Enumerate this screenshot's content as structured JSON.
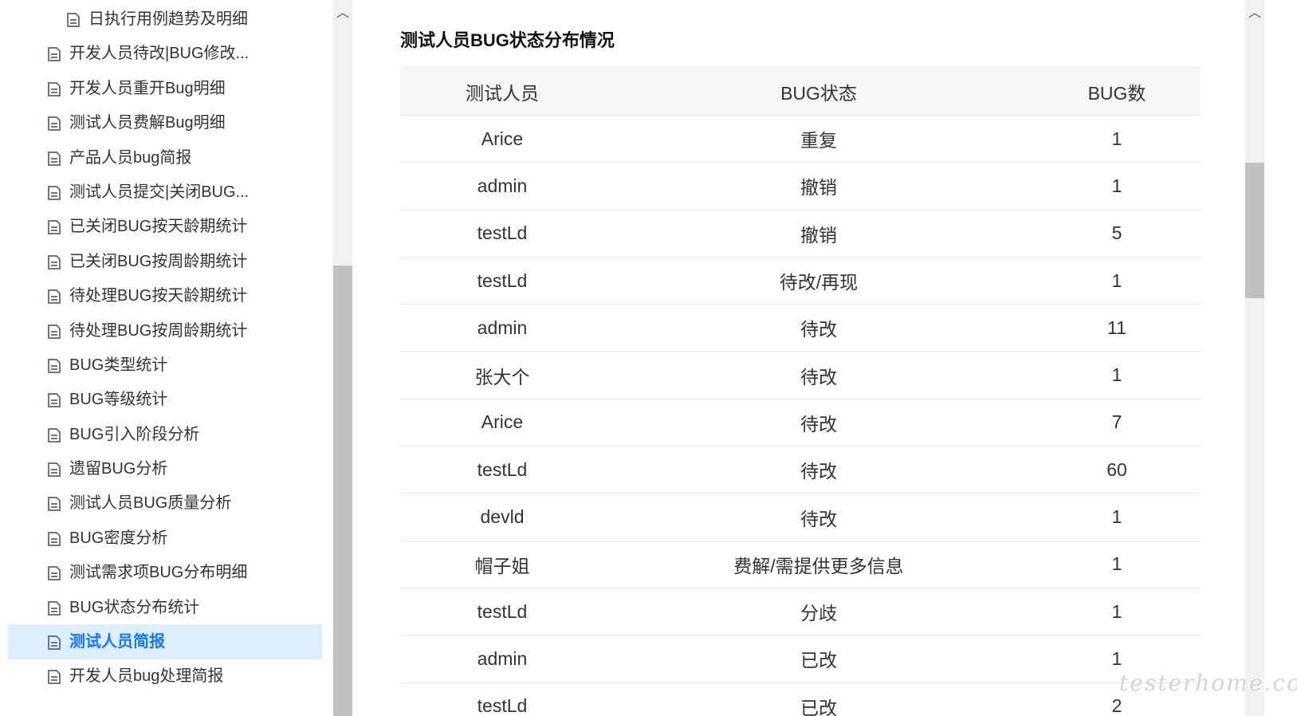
{
  "sidebar": {
    "items": [
      {
        "label": "日执行用例趋势及明细",
        "sub": true,
        "active": false
      },
      {
        "label": "开发人员待改|BUG修改...",
        "sub": false,
        "active": false
      },
      {
        "label": "开发人员重开Bug明细",
        "sub": false,
        "active": false
      },
      {
        "label": "测试人员费解Bug明细",
        "sub": false,
        "active": false
      },
      {
        "label": "产品人员bug简报",
        "sub": false,
        "active": false
      },
      {
        "label": "测试人员提交|关闭BUG...",
        "sub": false,
        "active": false
      },
      {
        "label": "已关闭BUG按天龄期统计",
        "sub": false,
        "active": false
      },
      {
        "label": "已关闭BUG按周龄期统计",
        "sub": false,
        "active": false
      },
      {
        "label": "待处理BUG按天龄期统计",
        "sub": false,
        "active": false
      },
      {
        "label": "待处理BUG按周龄期统计",
        "sub": false,
        "active": false
      },
      {
        "label": "BUG类型统计",
        "sub": false,
        "active": false
      },
      {
        "label": "BUG等级统计",
        "sub": false,
        "active": false
      },
      {
        "label": "BUG引入阶段分析",
        "sub": false,
        "active": false
      },
      {
        "label": "遗留BUG分析",
        "sub": false,
        "active": false
      },
      {
        "label": "测试人员BUG质量分析",
        "sub": false,
        "active": false
      },
      {
        "label": "BUG密度分析",
        "sub": false,
        "active": false
      },
      {
        "label": "测试需求项BUG分布明细",
        "sub": false,
        "active": false
      },
      {
        "label": "BUG状态分布统计",
        "sub": false,
        "active": false
      },
      {
        "label": "测试人员简报",
        "sub": false,
        "active": true
      },
      {
        "label": "开发人员bug处理简报",
        "sub": false,
        "active": false
      }
    ]
  },
  "report": {
    "title": "测试人员BUG状态分布情况",
    "columns": [
      "测试人员",
      "BUG状态",
      "BUG数"
    ],
    "rows": [
      [
        "Arice",
        "重复",
        "1"
      ],
      [
        "admin",
        "撤销",
        "1"
      ],
      [
        "testLd",
        "撤销",
        "5"
      ],
      [
        "testLd",
        "待改/再现",
        "1"
      ],
      [
        "admin",
        "待改",
        "11"
      ],
      [
        "张大个",
        "待改",
        "1"
      ],
      [
        "Arice",
        "待改",
        "7"
      ],
      [
        "testLd",
        "待改",
        "60"
      ],
      [
        "devld",
        "待改",
        "1"
      ],
      [
        "帽子姐",
        "费解/需提供更多信息",
        "1"
      ],
      [
        "testLd",
        "分歧",
        "1"
      ],
      [
        "admin",
        "已改",
        "1"
      ],
      [
        "testLd",
        "已改",
        "2"
      ]
    ]
  },
  "scroll": {
    "up_glyph": "︿"
  },
  "watermark": "testerhome.co",
  "colors": {
    "active_text": "#1677ff",
    "active_bg": "#ddeeff",
    "header_bg": "#f5f6f7",
    "icon": "#6b7785"
  }
}
